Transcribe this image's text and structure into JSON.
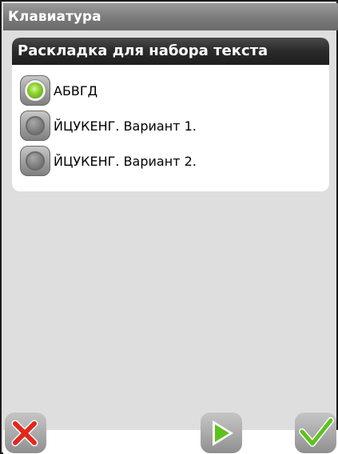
{
  "window": {
    "title": "Клавиатура"
  },
  "panel": {
    "header": "Раскладка для набора текста",
    "options": [
      {
        "label": "АБВГД",
        "selected": true
      },
      {
        "label": "ЙЦУКЕНГ. Вариант 1.",
        "selected": false
      },
      {
        "label": "ЙЦУКЕНГ. Вариант 2.",
        "selected": false
      }
    ]
  },
  "toolbar": {
    "cancel_icon": "close-icon",
    "next_icon": "play-icon",
    "ok_icon": "check-icon"
  },
  "colors": {
    "accent_green": "#5cc21c",
    "cancel_red": "#e0281c",
    "title_bar": "#8a8a8a",
    "panel_header": "#2a2a2a",
    "background": "#dedede"
  }
}
